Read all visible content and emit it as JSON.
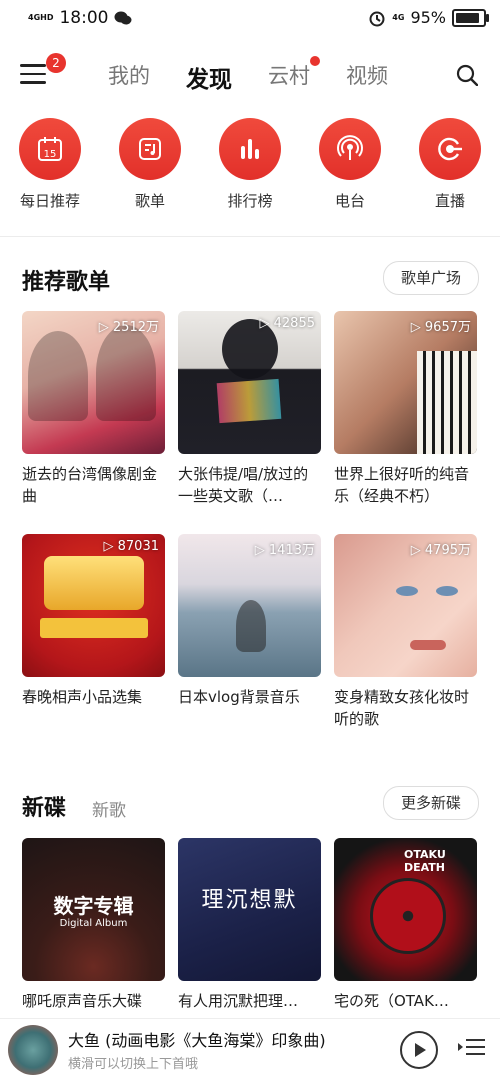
{
  "status": {
    "time": "18:00",
    "network": "4GHD",
    "network2": "4G",
    "battery": "95%"
  },
  "nav": {
    "badge": "2",
    "tabs": [
      "我的",
      "发现",
      "云村",
      "视频"
    ]
  },
  "quick": [
    {
      "label": "每日推荐",
      "icon": "calendar-icon",
      "num": "15"
    },
    {
      "label": "歌单",
      "icon": "playlist-icon"
    },
    {
      "label": "排行榜",
      "icon": "chart-bars-icon"
    },
    {
      "label": "电台",
      "icon": "radio-icon"
    },
    {
      "label": "直播",
      "icon": "live-icon"
    }
  ],
  "recommend": {
    "title": "推荐歌单",
    "more": "歌单广场",
    "items": [
      {
        "plays": "2512万",
        "title": "逝去的台湾偶像剧金曲"
      },
      {
        "plays": "42855",
        "title": "大张伟提/唱/放过的一些英文歌（…"
      },
      {
        "plays": "9657万",
        "title": "世界上很好听的纯音乐（经典不朽）"
      },
      {
        "plays": "87031",
        "title": "春晚相声小品选集"
      },
      {
        "plays": "1413万",
        "title": "日本vlog背景音乐"
      },
      {
        "plays": "4795万",
        "title": "变身精致女孩化妆时听的歌"
      }
    ]
  },
  "albums": {
    "title": "新碟",
    "sub": "新歌",
    "more": "更多新碟",
    "cover1_big": "数字专辑",
    "cover1_small": "Digital Album",
    "cover2": "理沉想默",
    "cover3": "OTAKU DEATH",
    "items": [
      {
        "title": "哪吒原声音乐大碟"
      },
      {
        "title": "有人用沉默把理…"
      },
      {
        "title": "宅の死（OTAK…"
      }
    ]
  },
  "player": {
    "title": "大鱼 (动画电影《大鱼海棠》印象曲)",
    "subtitle": "横滑可以切换上下首哦"
  },
  "colors": {
    "accent": "#e8342e"
  }
}
